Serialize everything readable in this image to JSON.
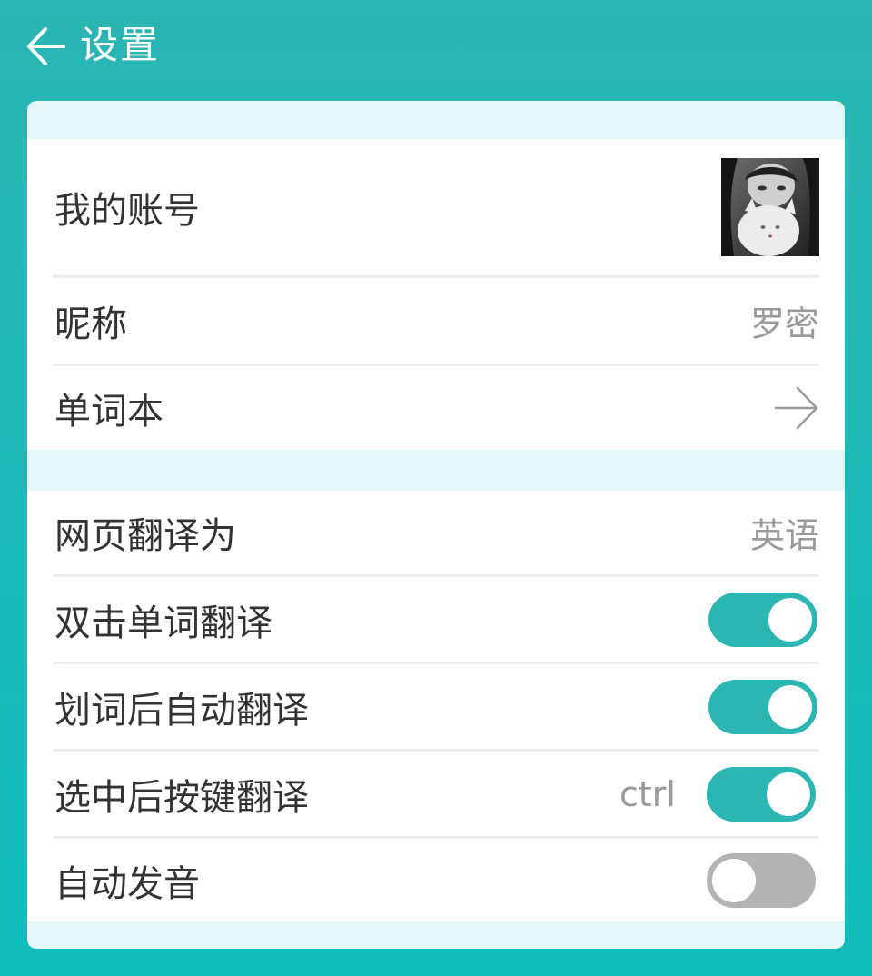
{
  "header": {
    "title": "设置"
  },
  "account": {
    "label": "我的账号"
  },
  "nickname": {
    "label": "昵称",
    "value": "罗密"
  },
  "wordbook": {
    "label": "单词本"
  },
  "webpage_translate": {
    "label": "网页翻译为",
    "value": "英语"
  },
  "toggles": [
    {
      "label": "双击单词翻译",
      "state": "on"
    },
    {
      "label": "划词后自动翻译",
      "state": "on"
    },
    {
      "label": "选中后按键翻译",
      "state": "on",
      "shortcut": "ctrl"
    },
    {
      "label": "自动发音",
      "state": "off"
    }
  ],
  "colors": {
    "accent": "#2bb5b3",
    "toggle_off": "#b3b3b3",
    "card_tint": "#e4f6f5"
  },
  "icons": {
    "back": "arrow-left-icon",
    "wordbook": "arrow-right-icon"
  }
}
